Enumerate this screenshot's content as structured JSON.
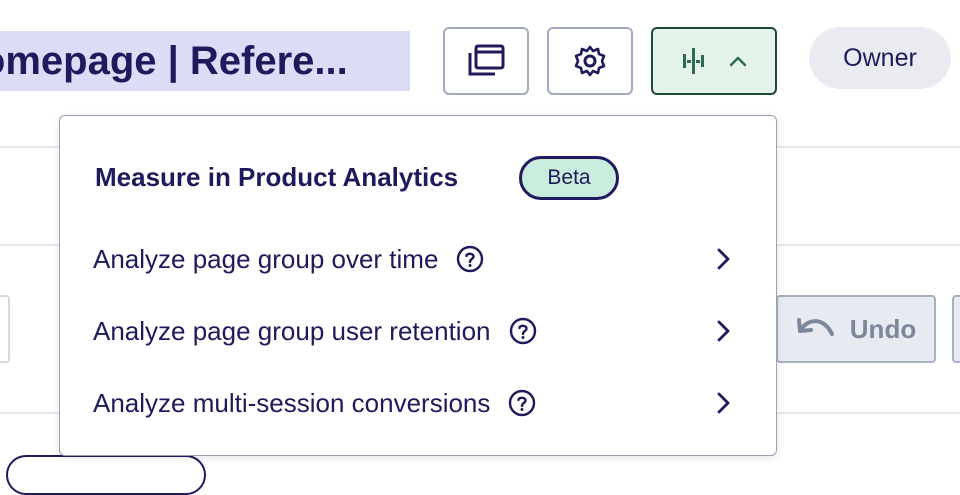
{
  "header": {
    "title": "Homepage | Refere...",
    "owner_label": "Owner",
    "icons": {
      "window": "window-copy-icon",
      "settings": "gear-icon",
      "analytics": "analytics-bars-icon",
      "chevron": "chevron-up-icon"
    }
  },
  "toolbar": {
    "undo_label": "Undo",
    "undo_icon": "undo-arrow-icon"
  },
  "menu": {
    "header": "Measure in Product Analytics",
    "badge": "Beta",
    "items": [
      {
        "label": "Analyze page group over time",
        "icon": "help-circle-icon"
      },
      {
        "label": "Analyze page group user retention",
        "icon": "help-circle-icon"
      },
      {
        "label": "Analyze multi-session conversions",
        "icon": "help-circle-icon"
      }
    ]
  },
  "colors": {
    "primary_text": "#1f1a5c",
    "title_highlight": "#dcdcf7",
    "active_button_bg": "#e4f3ea",
    "active_button_border": "#1f4a38",
    "beta_bg": "#c9ecdc"
  }
}
